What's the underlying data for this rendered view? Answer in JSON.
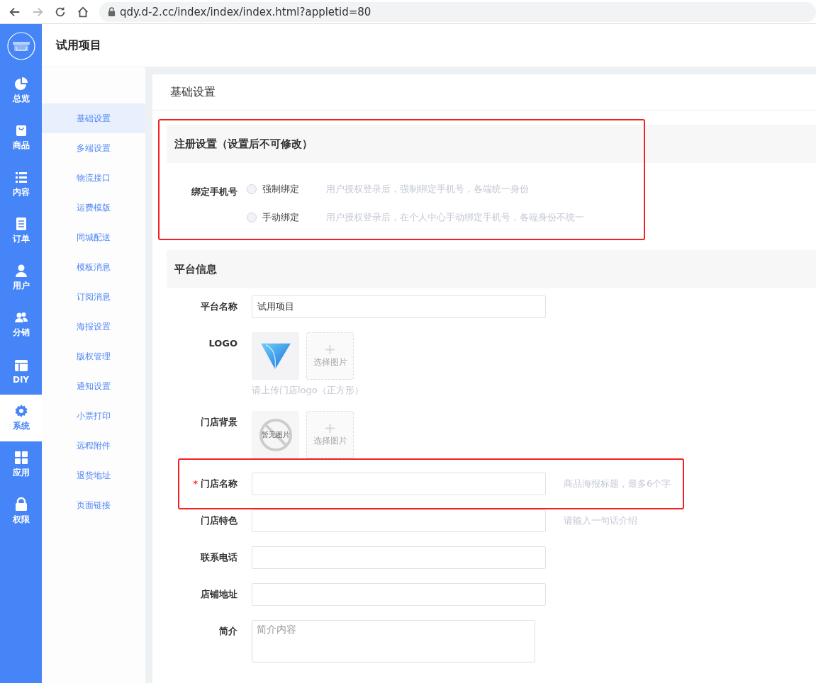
{
  "browser": {
    "url": "qdy.d-2.cc/index/index/index.html?appletid=80"
  },
  "rail": [
    {
      "kind": "pie",
      "label": "总览",
      "selected": false
    },
    {
      "kind": "bag",
      "label": "商品",
      "selected": false
    },
    {
      "kind": "list",
      "label": "内容",
      "selected": false
    },
    {
      "kind": "doc",
      "label": "订单",
      "selected": false
    },
    {
      "kind": "user",
      "label": "用户",
      "selected": false
    },
    {
      "kind": "users",
      "label": "分销",
      "selected": false
    },
    {
      "kind": "layout",
      "label": "DIY",
      "selected": false
    },
    {
      "kind": "gear",
      "label": "系统",
      "selected": true
    },
    {
      "kind": "grid",
      "label": "应用",
      "selected": false
    },
    {
      "kind": "lock",
      "label": "权限",
      "selected": false
    }
  ],
  "header": {
    "title": "试用项目"
  },
  "submenu": [
    {
      "label": "基础设置",
      "selected": true
    },
    {
      "label": "多端设置",
      "selected": false
    },
    {
      "label": "物流接口",
      "selected": false
    },
    {
      "label": "运费模版",
      "selected": false
    },
    {
      "label": "同城配送",
      "selected": false
    },
    {
      "label": "模板消息",
      "selected": false
    },
    {
      "label": "订阅消息",
      "selected": false
    },
    {
      "label": "海报设置",
      "selected": false
    },
    {
      "label": "版权管理",
      "selected": false
    },
    {
      "label": "通知设置",
      "selected": false
    },
    {
      "label": "小票打印",
      "selected": false
    },
    {
      "label": "远程附件",
      "selected": false
    },
    {
      "label": "退货地址",
      "selected": false
    },
    {
      "label": "页面链接",
      "selected": false
    }
  ],
  "card": {
    "title": "基础设置",
    "sections": [
      {
        "title": "注册设置（设置后不可修改）",
        "highlighted": true,
        "rows": [
          {
            "kind": "radio",
            "label": "绑定手机号",
            "options": [
              {
                "label": "强制绑定",
                "hint": "用户授权登录后，强制绑定手机号，各端统一身份",
                "checked": false
              },
              {
                "label": "手动绑定",
                "hint": "用户授权登录后，在个人中心手动绑定手机号，各端身份不统一",
                "checked": false
              }
            ]
          }
        ]
      },
      {
        "title": "平台信息",
        "highlighted": false,
        "rows": [
          {
            "kind": "text",
            "label": "平台名称",
            "value": "试用项目"
          },
          {
            "kind": "image",
            "label": "LOGO",
            "images": [
              {
                "kind": "logo"
              },
              {
                "kind": "add",
                "text": "选择图片"
              }
            ],
            "hint": "请上传门店logo（正方形）"
          },
          {
            "kind": "image",
            "label": "门店背景",
            "images": [
              {
                "kind": "empty",
                "text": "暂无图片"
              },
              {
                "kind": "add",
                "text": "选择图片"
              }
            ]
          },
          {
            "kind": "text",
            "label": "门店名称",
            "required_mark": "*",
            "value": "",
            "hint": "商品海报标题，最多6个字",
            "highlighted": true
          },
          {
            "kind": "text",
            "label": "门店特色",
            "value": "",
            "hint": "请输入一句话介绍"
          },
          {
            "kind": "text",
            "label": "联系电话",
            "value": ""
          },
          {
            "kind": "text",
            "label": "店铺地址",
            "value": ""
          },
          {
            "kind": "textarea",
            "label": "简介",
            "placeholder": "简介内容"
          }
        ]
      }
    ]
  }
}
